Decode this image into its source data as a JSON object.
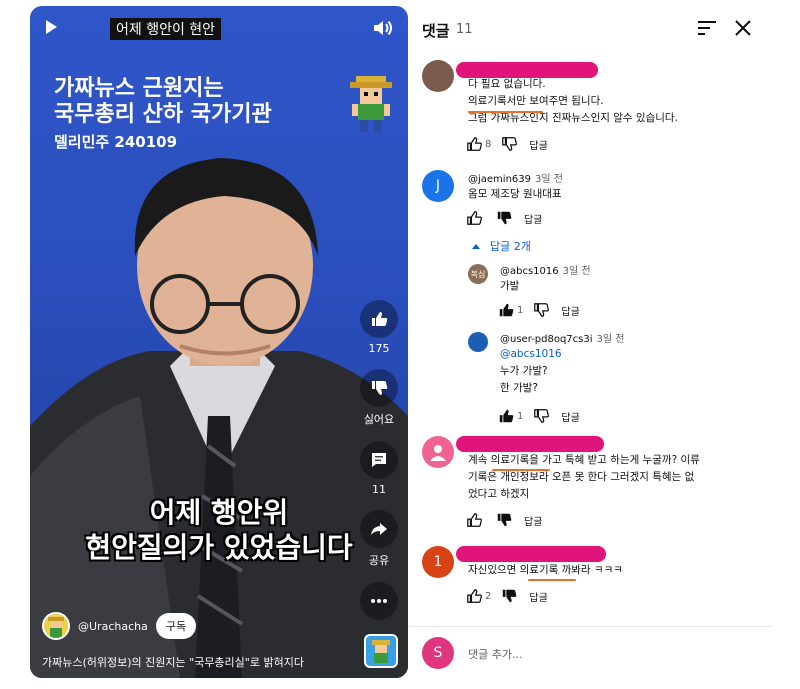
{
  "video": {
    "title": "어제 행안이 현안",
    "headline": {
      "line1": "가짜뉴스 근원지는",
      "line2": "국무총리 산하 국가기관",
      "line3": "델리민주 240109"
    },
    "caption": {
      "line1": "어제 행안위",
      "line2": "현안질의가 있었습니다"
    },
    "actions": {
      "like_count": "175",
      "dislike_label": "싫어요",
      "comment_count": "11",
      "share_label": "공유"
    },
    "channel": {
      "name": "@Urachacha",
      "subscribe_label": "구독"
    },
    "description": "가짜뉴스(허위정보)의 진원지는 \"국무총리실\"로 밝혀지다",
    "colors": {
      "background": "#2a4fbd"
    }
  },
  "panel": {
    "title": "댓글",
    "count": "11",
    "sort_icon": "sort-icon",
    "close_icon": "close-icon"
  },
  "comments": [
    {
      "lines": [
        "다 필요 없습니다.",
        "의료기록서만 보여주면 됩니다.",
        "그럼 가짜뉴스인지 진짜뉴스인지 알수 있습니다."
      ],
      "likes": "8",
      "reply_label": "답글",
      "avatar_color": "#7a5a4a"
    },
    {
      "handle": "@jaemin639",
      "time": "3일 전",
      "lines": [
        "옴모 제조당 원내대표"
      ],
      "reply_label": "답글",
      "avatar_letter": "J",
      "avatar_color": "#1a73e8",
      "replies_toggle": "답글 2개",
      "replies": [
        {
          "handle": "@abcs1016",
          "time": "3일 전",
          "lines": [
            "가발"
          ],
          "likes": "1",
          "reply_label": "답글",
          "avatar_text": "복심",
          "avatar_color": "#8a6f55"
        },
        {
          "handle": "@user-pd8oq7cs3i",
          "time": "3일 전",
          "mention": "@abcs1016",
          "lines": [
            "누가 가발?",
            "한 가발?"
          ],
          "likes": "1",
          "reply_label": "답글",
          "avatar_color": "#1a5fb4"
        }
      ]
    },
    {
      "lines": [
        "계속 의료기록을 가고 특혜 받고 하는게 누굴까? 이류",
        "기록은 개인정보라 오픈 못 한다 그러겠지 특혜는 없",
        "었다고 하겠지"
      ],
      "reply_label": "답글",
      "avatar_color": "#f06292"
    },
    {
      "lines": [
        "자신있으면 의료기록 까봐라 ㅋㅋㅋ"
      ],
      "likes": "2",
      "reply_label": "답글",
      "avatar_letter": "1",
      "avatar_color": "#d84315"
    }
  ],
  "composer": {
    "avatar_letter": "S",
    "placeholder": "댓글 추가..."
  },
  "colors": {
    "redaction": "#e0147a",
    "underline": "#e8702a",
    "link": "#065fd4"
  }
}
